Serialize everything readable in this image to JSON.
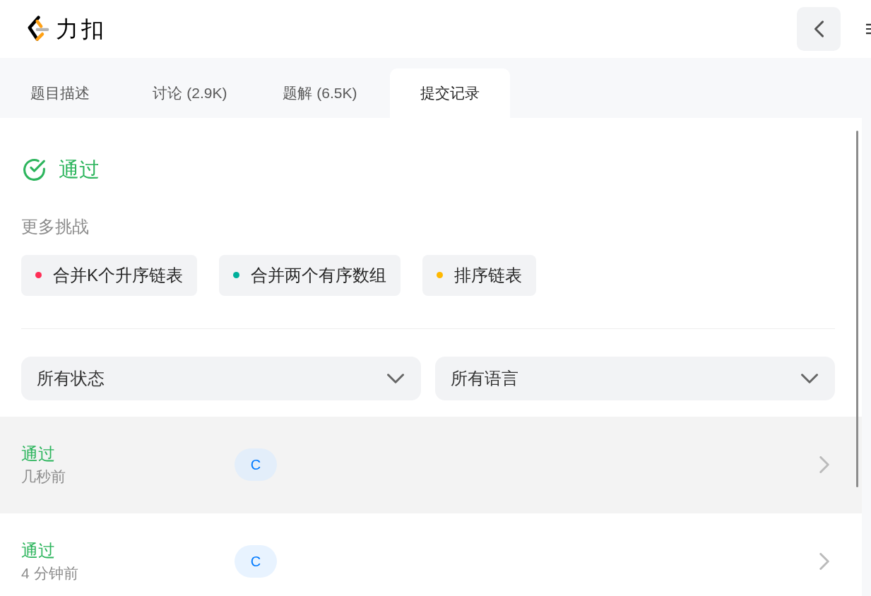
{
  "header": {
    "logo_text": "力扣"
  },
  "tabs": [
    {
      "label": "题目描述",
      "selected": false
    },
    {
      "label": "讨论 (2.9K)",
      "selected": false
    },
    {
      "label": "题解 (6.5K)",
      "selected": false
    },
    {
      "label": "提交记录",
      "selected": true
    }
  ],
  "result": {
    "status": "通过"
  },
  "more_challenges": {
    "title": "更多挑战",
    "items": [
      {
        "label": "合并K个升序链表",
        "color": "#ff2d55"
      },
      {
        "label": "合并两个有序数组",
        "color": "#00af9b"
      },
      {
        "label": "排序链表",
        "color": "#ffb800"
      }
    ]
  },
  "filters": [
    {
      "value": "所有状态"
    },
    {
      "value": "所有语言"
    }
  ],
  "submissions": [
    {
      "status": "通过",
      "time": "几秒前",
      "language": "C",
      "selected": true
    },
    {
      "status": "通过",
      "time": "4 分钟前",
      "language": "C",
      "selected": false
    }
  ]
}
